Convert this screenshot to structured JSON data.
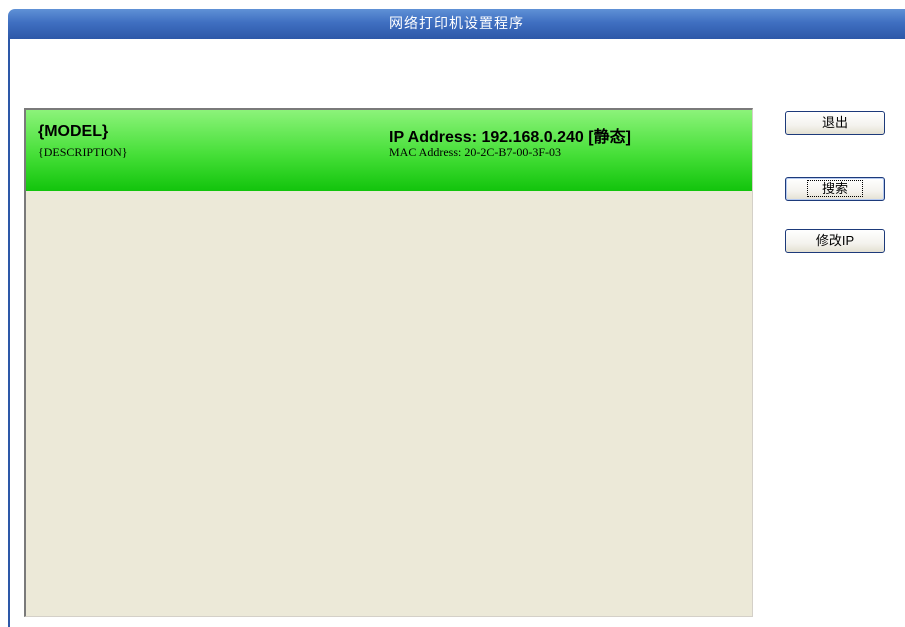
{
  "window": {
    "title": "网络打印机设置程序"
  },
  "device_list": {
    "items": [
      {
        "model": "{MODEL}",
        "description": "{DESCRIPTION}",
        "ip_line": "IP Address: 192.168.0.240 [静态]",
        "mac_line": "MAC Address: 20-2C-B7-00-3F-03",
        "selected": true
      }
    ]
  },
  "buttons": {
    "exit_label": "退出",
    "search_label": "搜索",
    "modify_ip_label": "修改IP"
  },
  "colors": {
    "titlebar": "#3f6fc1",
    "selected_item": "#46df38",
    "panel_background": "#ece9d8"
  }
}
